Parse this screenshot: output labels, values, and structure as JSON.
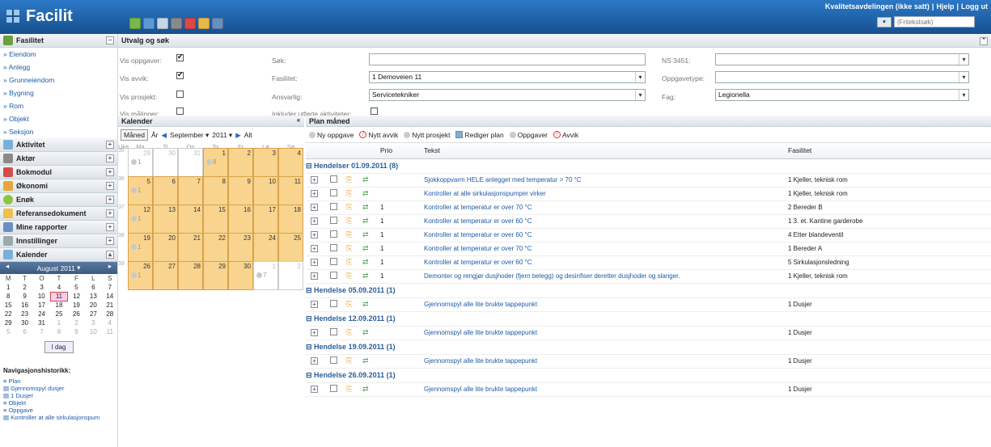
{
  "app": {
    "title": "Facilit"
  },
  "header": {
    "links": [
      "Kvalitetsavdelingen (ikke satt)",
      "Hjelp",
      "Logg ut"
    ],
    "search_placeholder": "(Fritekstsøk)"
  },
  "sidebar": {
    "fasilitet": {
      "label": "Fasilitet",
      "items": [
        "» Eiendom",
        "» Anlegg",
        "» Grunneiendom",
        "» Bygning",
        "» Rom",
        "» Objekt",
        "» Seksjon"
      ]
    },
    "panels": [
      "Aktivitet",
      "Aktør",
      "Bokmodul",
      "Økonomi",
      "Enøk",
      "Referansedokument",
      "Mine rapporter",
      "Innstillinger"
    ],
    "kalender": "Kalender",
    "minical": {
      "month": "August 2011",
      "weekdays": [
        "M",
        "T",
        "O",
        "T",
        "F",
        "L",
        "S"
      ],
      "weeks": [
        [
          "1",
          "2",
          "3",
          "4",
          "5",
          "6",
          "7"
        ],
        [
          "8",
          "9",
          "10",
          "11",
          "12",
          "13",
          "14"
        ],
        [
          "15",
          "16",
          "17",
          "18",
          "19",
          "20",
          "21"
        ],
        [
          "22",
          "23",
          "24",
          "25",
          "26",
          "27",
          "28"
        ],
        [
          "29",
          "30",
          "31",
          "1",
          "2",
          "3",
          "4"
        ],
        [
          "5",
          "6",
          "7",
          "8",
          "9",
          "10",
          "11"
        ]
      ],
      "today_label": "I dag"
    },
    "nav_history": {
      "title": "Navigasjonshistorikk:",
      "items": [
        "Plan",
        "Gjennomspyl dusjer",
        "1 Dusjer",
        "Objekt",
        "Oppgave",
        "Kontroller at alle sirkulasjonspum"
      ]
    }
  },
  "filters": {
    "title": "Utvalg og søk",
    "labels": {
      "vis_oppgaver": "Vis oppgaver:",
      "vis_avvik": "Vis avvik:",
      "vis_prosjekt": "Vis prosjekt:",
      "vis_malinger": "Vis målinger:",
      "sok": "Søk:",
      "fasilitet": "Fasilitet:",
      "ansvarlig": "Ansvarlig:",
      "inkluder": "Inkluder utførte aktiviteter:",
      "ns3451": "NS 3451:",
      "oppgavetype": "Oppgavetype:",
      "fag": "Fag:"
    },
    "values": {
      "sok": "",
      "fasilitet": "1 Demoveien 11",
      "ansvarlig": "Servicetekniker",
      "ns3451": "",
      "oppgavetype": "",
      "fag": "Legionella"
    }
  },
  "calendar": {
    "title": "Kalender",
    "view_month": "Måned",
    "view_year": "År",
    "month": "September",
    "year": "2011",
    "all": "Alt",
    "header": [
      "Uke",
      "Ma",
      "Ti",
      "On",
      "To",
      "Fr",
      "Lø",
      "Sø"
    ],
    "weeks": [
      {
        "num": "35",
        "days": [
          [
            "29",
            0,
            ""
          ],
          [
            "30",
            0,
            ""
          ],
          [
            "31",
            0,
            ""
          ],
          [
            "1",
            1,
            "8"
          ],
          [
            "2",
            1,
            ""
          ],
          [
            "3",
            1,
            ""
          ],
          [
            "4",
            1,
            ""
          ]
        ],
        "first": "1"
      },
      {
        "num": "36",
        "days": [
          [
            "5",
            1,
            "1"
          ],
          [
            "6",
            1,
            ""
          ],
          [
            "7",
            1,
            ""
          ],
          [
            "8",
            1,
            ""
          ],
          [
            "9",
            1,
            ""
          ],
          [
            "10",
            1,
            ""
          ],
          [
            "11",
            1,
            ""
          ]
        ]
      },
      {
        "num": "37",
        "days": [
          [
            "12",
            1,
            "1"
          ],
          [
            "13",
            1,
            ""
          ],
          [
            "14",
            1,
            ""
          ],
          [
            "15",
            1,
            ""
          ],
          [
            "16",
            1,
            ""
          ],
          [
            "17",
            1,
            ""
          ],
          [
            "18",
            1,
            ""
          ]
        ]
      },
      {
        "num": "38",
        "days": [
          [
            "19",
            1,
            "1"
          ],
          [
            "20",
            1,
            ""
          ],
          [
            "21",
            1,
            ""
          ],
          [
            "22",
            1,
            ""
          ],
          [
            "23",
            1,
            ""
          ],
          [
            "24",
            1,
            ""
          ],
          [
            "25",
            1,
            ""
          ]
        ]
      },
      {
        "num": "39",
        "days": [
          [
            "26",
            1,
            "1"
          ],
          [
            "27",
            1,
            ""
          ],
          [
            "28",
            1,
            ""
          ],
          [
            "29",
            1,
            ""
          ],
          [
            "30",
            1,
            ""
          ],
          [
            "1",
            0,
            "7"
          ],
          [
            "2",
            0,
            ""
          ]
        ]
      }
    ],
    "w35_mon_dot": "1"
  },
  "plan": {
    "title": "Plan måned",
    "toolbar": [
      "Ny oppgave",
      "Nytt avvik",
      "Nytt prosjekt",
      "Rediger plan",
      "Oppgaver",
      "Avvik"
    ],
    "columns": {
      "prio": "Prio",
      "tekst": "Tekst",
      "fasilitet": "Fasilitet"
    },
    "groups": [
      {
        "title": "Hendelser 01.09.2011 (8)",
        "rows": [
          {
            "prio": "",
            "text": "Sjokkoppvarm HELE anlegget med temperatur > 70 °C",
            "fac": "1 Kjeller, teknisk rom"
          },
          {
            "prio": "",
            "text": "Kontroller at alle sirkulasjonspumper virker",
            "fac": "1 Kjeller, teknisk rom"
          },
          {
            "prio": "1",
            "text": "Kontroller at temperatur er over 70 °C",
            "fac": "2 Bereder B"
          },
          {
            "prio": "1",
            "text": "Kontroller at temperatur er over 60 °C",
            "fac": "1 3. et. Kantine garderobe"
          },
          {
            "prio": "1",
            "text": "Kontroller at temperatur er over 60 °C",
            "fac": "4 Etter blandeventil"
          },
          {
            "prio": "1",
            "text": "Kontroller at temperatur er over 70 °C",
            "fac": "1 Bereder A"
          },
          {
            "prio": "1",
            "text": "Kontroller at temperatur er over 60 °C",
            "fac": "5 Sirkulasjonsledning"
          },
          {
            "prio": "1",
            "text": "Demonter og rengjør dusjhoder (fjern belegg) og desinfiser deretter dusjhoder og slanger.",
            "fac": "1 Kjeller, teknisk rom"
          }
        ]
      },
      {
        "title": "Hendelse 05.09.2011 (1)",
        "rows": [
          {
            "prio": "",
            "text": "Gjennomspyl alle lite brukte tappepunkt",
            "fac": "1 Dusjer"
          }
        ]
      },
      {
        "title": "Hendelse 12.09.2011 (1)",
        "rows": [
          {
            "prio": "",
            "text": "Gjennomspyl alle lite brukte tappepunkt",
            "fac": "1 Dusjer"
          }
        ]
      },
      {
        "title": "Hendelse 19.09.2011 (1)",
        "rows": [
          {
            "prio": "",
            "text": "Gjennomspyl alle lite brukte tappepunkt",
            "fac": "1 Dusjer"
          }
        ]
      },
      {
        "title": "Hendelse 26.09.2011 (1)",
        "rows": [
          {
            "prio": "",
            "text": "Gjennomspyl alle lite brukte tappepunkt",
            "fac": "1 Dusjer"
          }
        ]
      }
    ]
  },
  "colors": {
    "accent": "#1e5aa8",
    "calendar_day": "#f8d48f",
    "topbar": "#16508f"
  },
  "icons": {
    "expand": "plus-icon",
    "checkbox": "checkbox-icon",
    "task": "task-icon",
    "refresh": "refresh-icon"
  }
}
